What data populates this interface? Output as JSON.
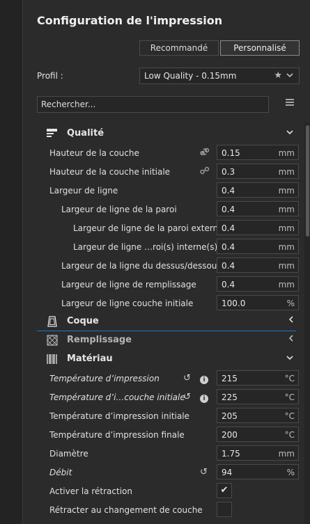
{
  "panel": {
    "title": "Configuration de l'impression"
  },
  "mode": {
    "recommended": "Recommandé",
    "custom": "Personnalisé"
  },
  "profile": {
    "label": "Profil :",
    "value": "Low Quality - 0.15mm"
  },
  "search": {
    "placeholder": "Rechercher..."
  },
  "categories": {
    "qualite": "Qualité",
    "coque": "Coque",
    "remplissage": "Remplissage",
    "materiau": "Matériau"
  },
  "settings": [
    {
      "label": "Hauteur de la couche",
      "value": "0.15",
      "unit": "mm"
    },
    {
      "label": "Hauteur de la couche initiale",
      "value": "0.3",
      "unit": "mm"
    },
    {
      "label": "Largeur de ligne",
      "value": "0.4",
      "unit": "mm"
    },
    {
      "label": "Largeur de ligne de la paroi",
      "value": "0.4",
      "unit": "mm"
    },
    {
      "label": "Largeur de ligne de la paroi externe",
      "value": "0.4",
      "unit": "mm"
    },
    {
      "label": "Largeur de ligne …roi(s) interne(s)",
      "value": "0.4",
      "unit": "mm"
    },
    {
      "label": "Largeur de la ligne du dessus/dessous",
      "value": "0.4",
      "unit": "mm"
    },
    {
      "label": "Largeur de ligne de remplissage",
      "value": "0.4",
      "unit": "mm"
    },
    {
      "label": "Largeur de ligne couche initiale",
      "value": "100.0",
      "unit": "%"
    },
    {
      "label": "Température d’impression",
      "value": "215",
      "unit": "°C"
    },
    {
      "label": "Température d’i…couche initiale",
      "value": "225",
      "unit": "°C"
    },
    {
      "label": "Température d’impression initiale",
      "value": "205",
      "unit": "°C"
    },
    {
      "label": "Température d’impression finale",
      "value": "200",
      "unit": "°C"
    },
    {
      "label": "Diamètre",
      "value": "1.75",
      "unit": "mm"
    },
    {
      "label": "Débit",
      "value": "94",
      "unit": "%"
    },
    {
      "label": "Activer la rétraction",
      "checked": true
    },
    {
      "label": "Rétracter au changement de couche",
      "checked": false
    }
  ],
  "glyphs": {
    "check": "✔",
    "star": "★",
    "chevron_down": "⌄",
    "chevron_left": "‹",
    "reset": "↺",
    "info": "i",
    "link": "⚭",
    "menu": "≡"
  },
  "colors": {
    "accent": "#2c6fb8",
    "panel_bg": "#2b2b2b",
    "field_bg": "#262626"
  }
}
